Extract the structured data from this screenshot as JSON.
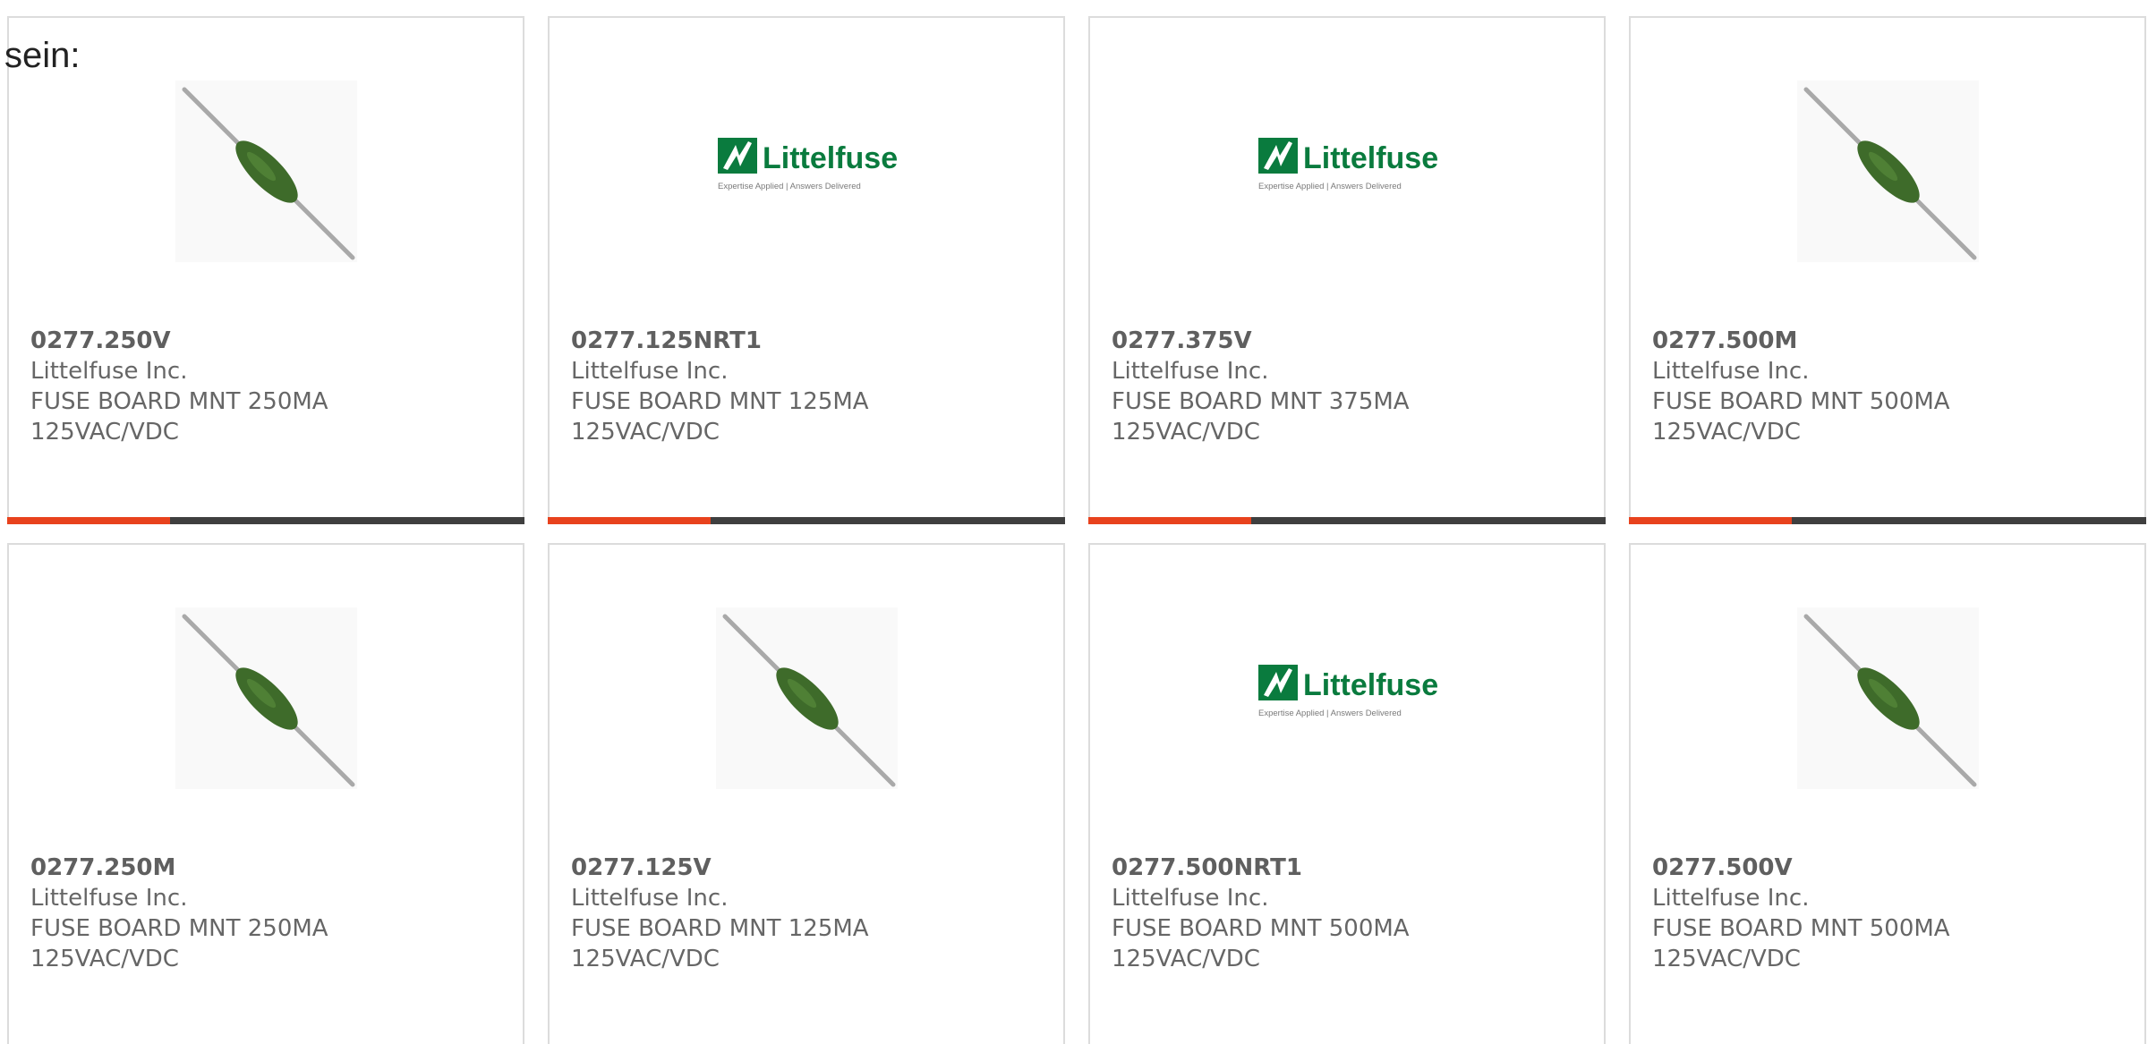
{
  "intro": {
    "text": "sein:"
  },
  "products": [
    {
      "part": "0277.250V",
      "maker": "Littelfuse Inc.",
      "desc1": "FUSE BOARD MNT 250MA",
      "desc2": "125VAC/VDC",
      "image": "fuse-photo"
    },
    {
      "part": "0277.125NRT1",
      "maker": "Littelfuse Inc.",
      "desc1": "FUSE BOARD MNT 125MA",
      "desc2": "125VAC/VDC",
      "image": "littelfuse-logo"
    },
    {
      "part": "0277.375V",
      "maker": "Littelfuse Inc.",
      "desc1": "FUSE BOARD MNT 375MA",
      "desc2": "125VAC/VDC",
      "image": "littelfuse-logo"
    },
    {
      "part": "0277.500M",
      "maker": "Littelfuse Inc.",
      "desc1": "FUSE BOARD MNT 500MA",
      "desc2": "125VAC/VDC",
      "image": "fuse-photo"
    },
    {
      "part": "0277.250M",
      "maker": "Littelfuse Inc.",
      "desc1": "FUSE BOARD MNT 250MA",
      "desc2": "125VAC/VDC",
      "image": "fuse-photo"
    },
    {
      "part": "0277.125V",
      "maker": "Littelfuse Inc.",
      "desc1": "FUSE BOARD MNT 125MA",
      "desc2": "125VAC/VDC",
      "image": "fuse-photo"
    },
    {
      "part": "0277.500NRT1",
      "maker": "Littelfuse Inc.",
      "desc1": "FUSE BOARD MNT 500MA",
      "desc2": "125VAC/VDC",
      "image": "littelfuse-logo"
    },
    {
      "part": "0277.500V",
      "maker": "Littelfuse Inc.",
      "desc1": "FUSE BOARD MNT 500MA",
      "desc2": "125VAC/VDC",
      "image": "fuse-photo"
    }
  ],
  "logo": {
    "name": "Littelfuse",
    "tagline": "Expertise Applied | Answers Delivered"
  },
  "colors": {
    "accent": "#e8421d",
    "bar": "#3f3f3f",
    "logo_green": "#0a7b3e",
    "fuse_green": "#3e6b2a"
  }
}
